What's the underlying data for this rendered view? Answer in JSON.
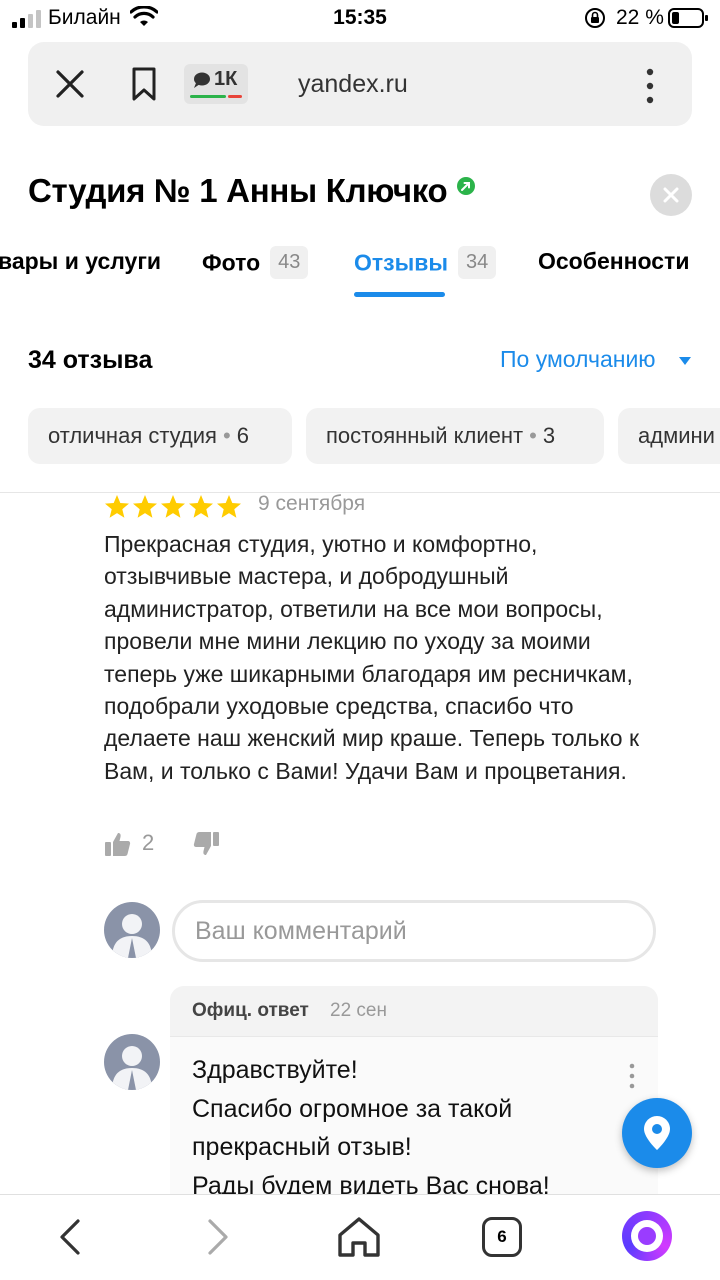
{
  "status_bar": {
    "carrier": "Билайн",
    "time": "15:35",
    "battery": "22 %"
  },
  "browser": {
    "badge": "1К",
    "domain": "yandex.ru"
  },
  "header": {
    "title": "Студия № 1 Анны Ключко"
  },
  "tabs": [
    {
      "label": "вары и услуги",
      "count": null,
      "active": false
    },
    {
      "label": "Фото",
      "count": "43",
      "active": false
    },
    {
      "label": "Отзывы",
      "count": "34",
      "active": true
    },
    {
      "label": "Особенности",
      "count": null,
      "active": false
    }
  ],
  "reviews": {
    "count_label": "34 отзыва",
    "sort_label": "По умолчанию"
  },
  "chips": [
    {
      "label": "отличная студия",
      "count": "6"
    },
    {
      "label": "постоянный клиент",
      "count": "3"
    },
    {
      "label": "админи",
      "count": null
    }
  ],
  "review": {
    "rating": 5,
    "date": "9 сентября",
    "text": "Прекрасная студия, уютно и комфортно, отзывчивые мастера, и добродушный администратор, ответили на все мои вопросы, провели мне мини лекцию по уходу за моими теперь уже шикарными благодаря им ресничкам, подобрали уходовые средства, спасибо что делаете наш женский мир краше. Теперь только к Вам, и только с Вами! Удачи Вам и процветания.",
    "likes": "2"
  },
  "comment": {
    "placeholder": "Ваш комментарий"
  },
  "official_reply": {
    "label": "Офиц. ответ",
    "date": "22 сен",
    "lines": [
      "Здравствуйте!",
      "Спасибо огромное за такой",
      "прекрасный отзыв!",
      "Рады будем видеть Вас снова!"
    ]
  },
  "bottom_nav": {
    "tabs_count": "6"
  },
  "colors": {
    "accent": "#1b8bea",
    "star": "#ffcc00",
    "verified": "#2bb34a",
    "alice": "#9a3cff"
  }
}
